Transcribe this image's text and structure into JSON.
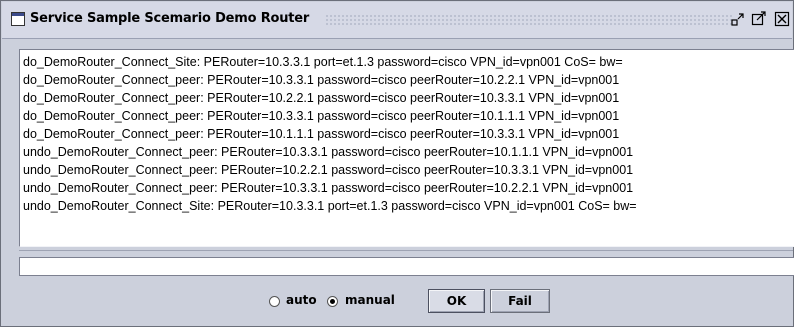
{
  "window": {
    "title": "Service Sample Scemario Demo Router"
  },
  "log": {
    "lines": [
      "do_DemoRouter_Connect_Site: PERouter=10.3.3.1 port=et.1.3 password=cisco VPN_id=vpn001 CoS= bw=",
      "do_DemoRouter_Connect_peer: PERouter=10.3.3.1 password=cisco peerRouter=10.2.2.1 VPN_id=vpn001",
      "do_DemoRouter_Connect_peer: PERouter=10.2.2.1 password=cisco peerRouter=10.3.3.1 VPN_id=vpn001",
      "do_DemoRouter_Connect_peer: PERouter=10.3.3.1 password=cisco peerRouter=10.1.1.1 VPN_id=vpn001",
      "do_DemoRouter_Connect_peer: PERouter=10.1.1.1 password=cisco peerRouter=10.3.3.1 VPN_id=vpn001",
      "undo_DemoRouter_Connect_peer: PERouter=10.3.3.1 password=cisco peerRouter=10.1.1.1 VPN_id=vpn001",
      "undo_DemoRouter_Connect_peer: PERouter=10.2.2.1 password=cisco peerRouter=10.3.3.1 VPN_id=vpn001",
      "undo_DemoRouter_Connect_peer: PERouter=10.3.3.1 password=cisco peerRouter=10.2.2.1 VPN_id=vpn001",
      "undo_DemoRouter_Connect_Site: PERouter=10.3.3.1 port=et.1.3 password=cisco VPN_id=vpn001 CoS= bw="
    ]
  },
  "input": {
    "value": ""
  },
  "mode": {
    "auto_label": "auto",
    "manual_label": "manual",
    "selected": "manual"
  },
  "buttons": {
    "ok_label": "OK",
    "fail_label": "Fail"
  },
  "icons": {
    "window": "window-icon",
    "minimize": "minimize-icon",
    "maximize": "maximize-icon",
    "close": "close-icon"
  }
}
